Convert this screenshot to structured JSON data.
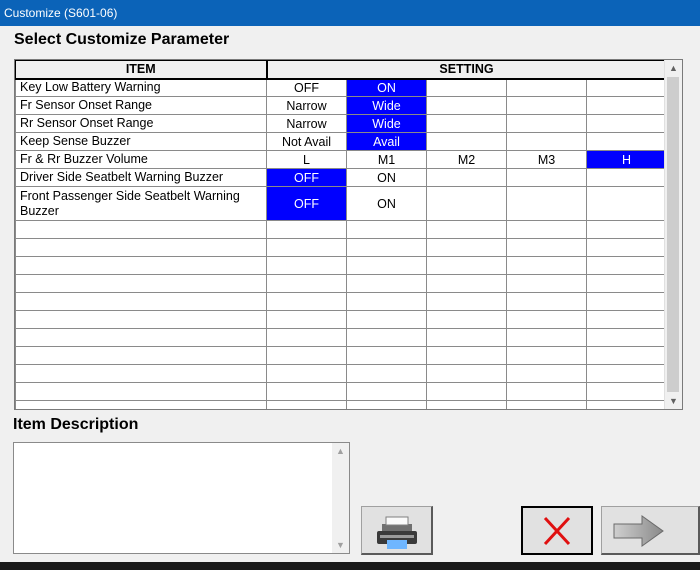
{
  "window": {
    "title": "Customize (S601-06)"
  },
  "select_heading": "Select Customize Parameter",
  "grid": {
    "headers": {
      "item": "ITEM",
      "setting": "SETTING"
    },
    "rows": [
      {
        "item": "Key Low Battery Warning",
        "options": [
          "OFF",
          "ON",
          "",
          "",
          ""
        ],
        "selected": 1
      },
      {
        "item": "Fr Sensor Onset Range",
        "options": [
          "Narrow",
          "Wide",
          "",
          "",
          ""
        ],
        "selected": 1
      },
      {
        "item": "Rr Sensor Onset Range",
        "options": [
          "Narrow",
          "Wide",
          "",
          "",
          ""
        ],
        "selected": 1
      },
      {
        "item": "Keep Sense Buzzer",
        "options": [
          "Not Avail",
          "Avail",
          "",
          "",
          ""
        ],
        "selected": 1
      },
      {
        "item": "Fr & Rr Buzzer Volume",
        "options": [
          "L",
          "M1",
          "M2",
          "M3",
          "H"
        ],
        "selected": 4
      },
      {
        "item": "Driver Side Seatbelt Warning Buzzer",
        "options": [
          "OFF",
          "ON",
          "",
          "",
          ""
        ],
        "selected": 0
      },
      {
        "item": "Front Passenger Side Seatbelt Warning Buzzer",
        "options": [
          "OFF",
          "ON",
          "",
          "",
          ""
        ],
        "selected": 0
      }
    ],
    "selected_color": "#0000ff"
  },
  "description": {
    "heading": "Item Description",
    "text": ""
  },
  "buttons": {
    "print_icon": "printer-icon",
    "cancel_icon": "red-x-icon",
    "next_icon": "right-arrow-icon"
  }
}
